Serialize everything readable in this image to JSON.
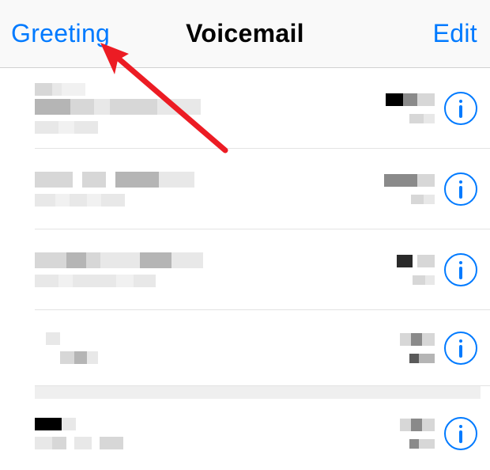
{
  "navbar": {
    "left_label": "Greeting",
    "title": "Voicemail",
    "right_label": "Edit"
  },
  "colors": {
    "accent": "#007aff",
    "annotation": "#ec1c24"
  },
  "voicemails": [
    {
      "id": 1
    },
    {
      "id": 2
    },
    {
      "id": 3
    },
    {
      "id": 4
    },
    {
      "id": 5
    }
  ],
  "annotation": {
    "type": "arrow",
    "target": "greeting-button"
  }
}
